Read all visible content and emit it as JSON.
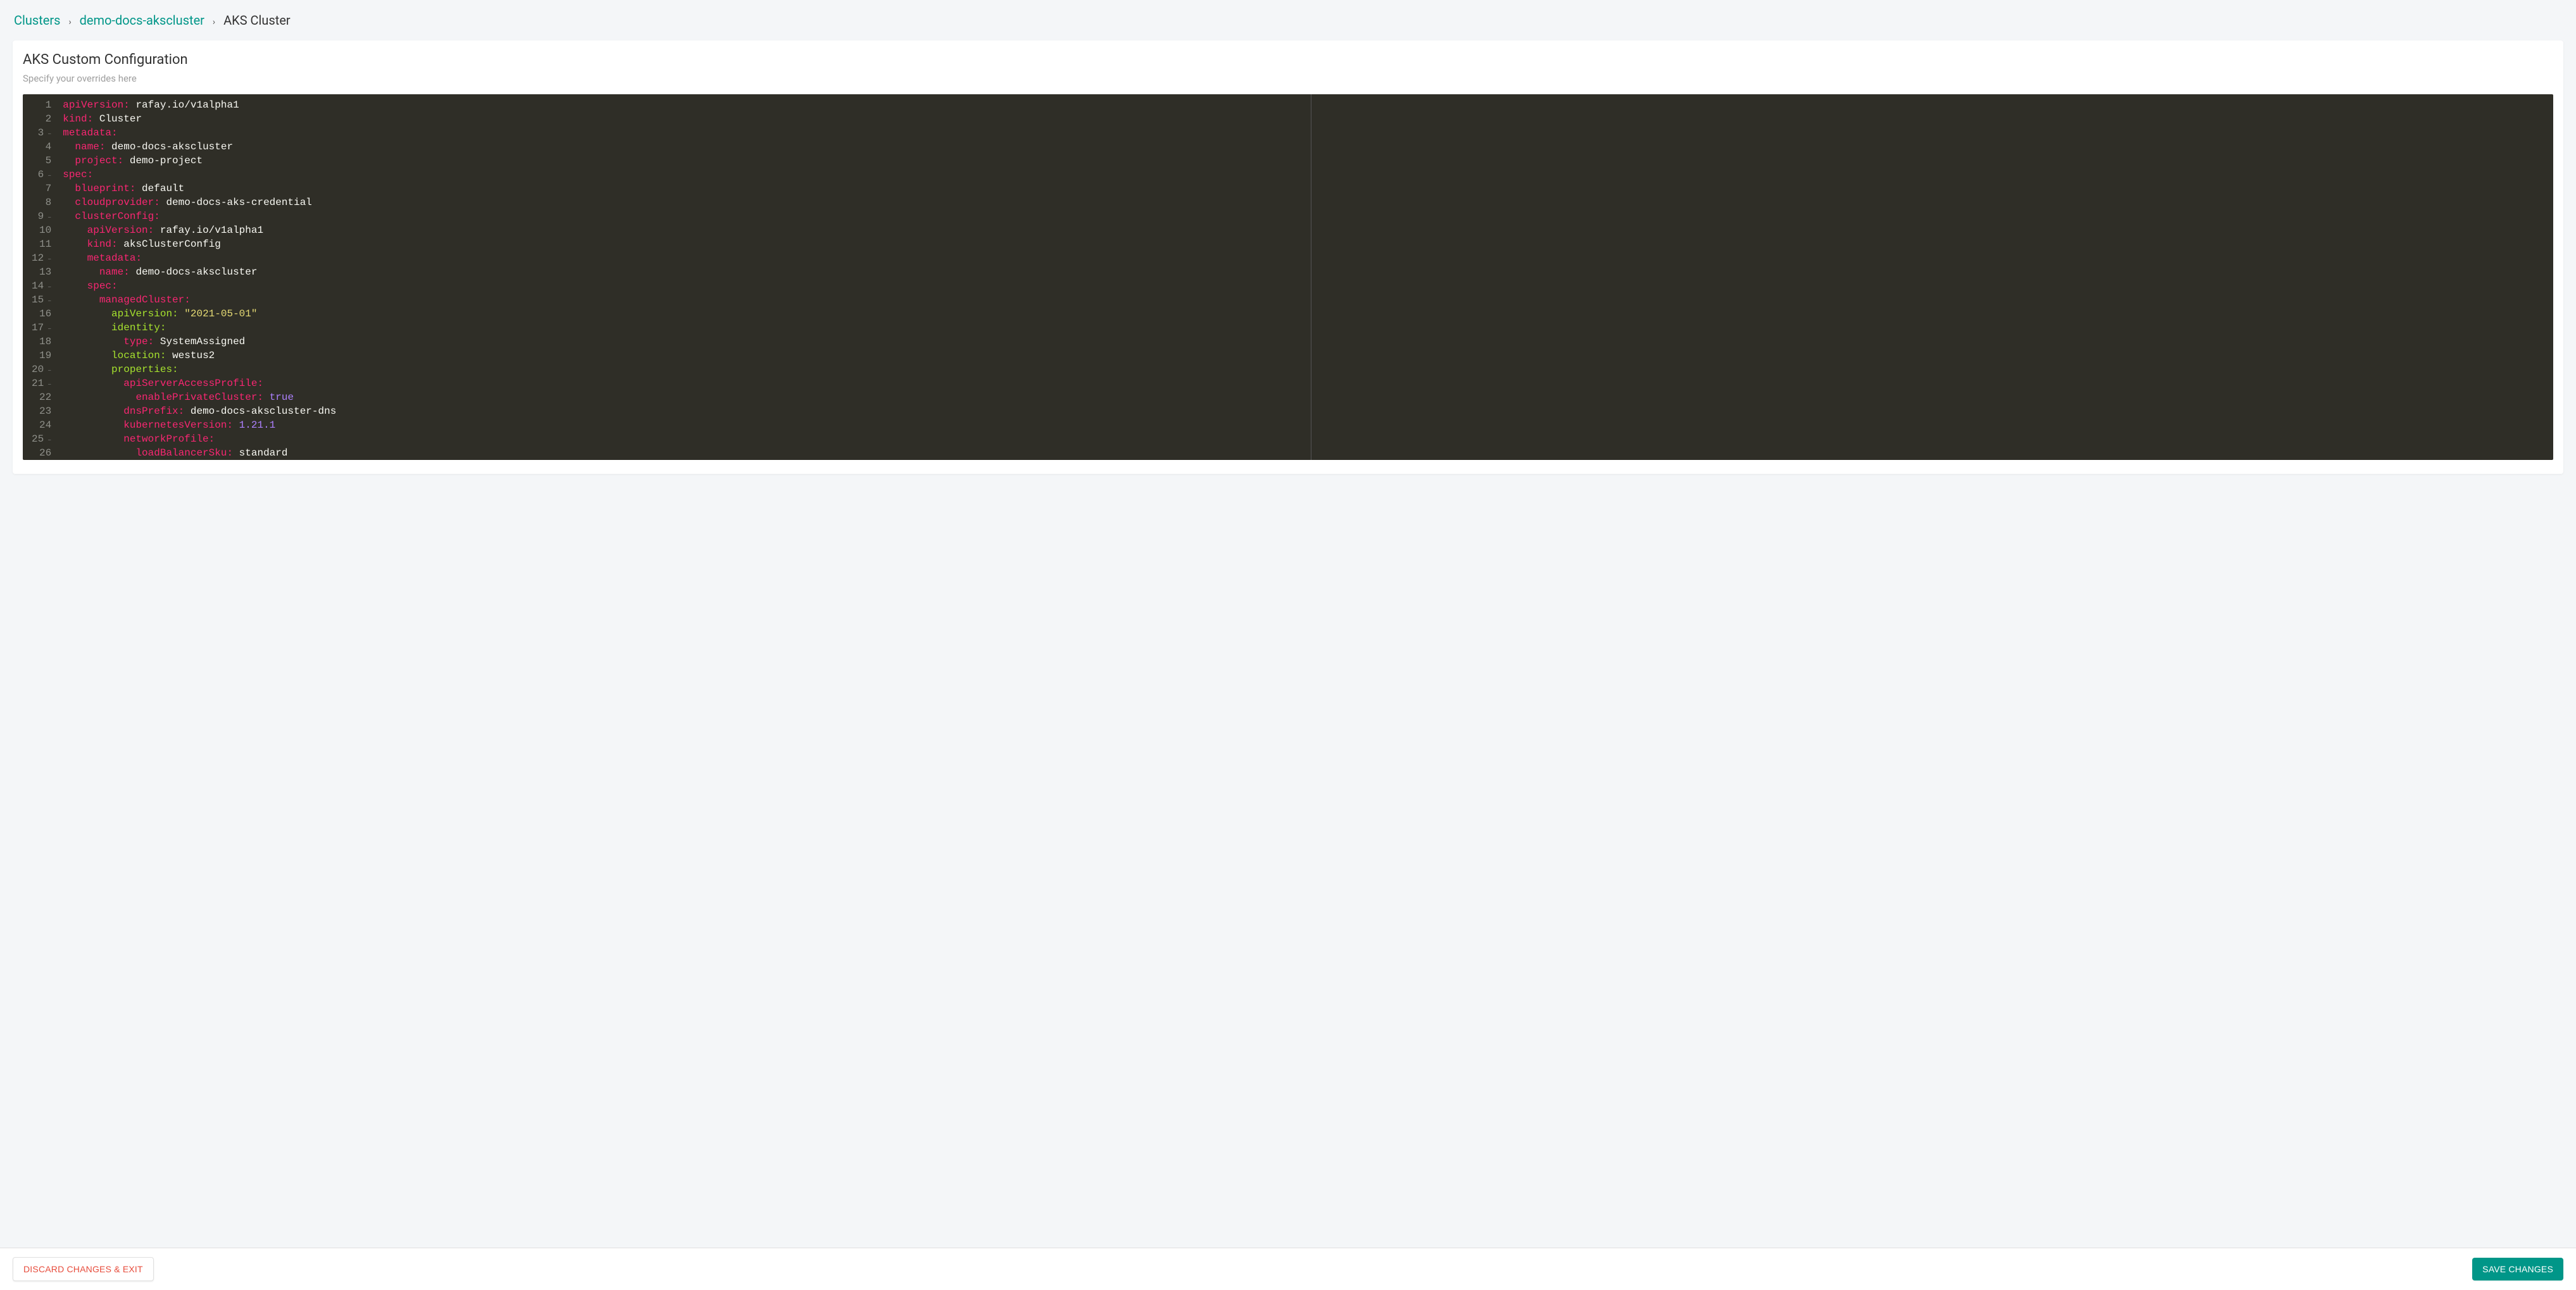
{
  "breadcrumb": {
    "root": "Clusters",
    "mid": "demo-docs-akscluster",
    "leaf": "AKS Cluster",
    "sep": "›"
  },
  "card": {
    "title": "AKS Custom Configuration",
    "sub": "Specify your overrides here"
  },
  "buttons": {
    "discard": "DISCARD CHANGES & EXIT",
    "save": "SAVE CHANGES"
  },
  "editor": {
    "lines": [
      {
        "n": 1,
        "fold": false,
        "tokens": [
          [
            "key",
            "apiVersion:"
          ],
          [
            "sp",
            " "
          ],
          [
            "val",
            "rafay.io/v1alpha1"
          ]
        ]
      },
      {
        "n": 2,
        "fold": false,
        "tokens": [
          [
            "key",
            "kind:"
          ],
          [
            "sp",
            " "
          ],
          [
            "val",
            "Cluster"
          ]
        ]
      },
      {
        "n": 3,
        "fold": true,
        "tokens": [
          [
            "key",
            "metadata:"
          ]
        ]
      },
      {
        "n": 4,
        "fold": false,
        "tokens": [
          [
            "sp",
            "  "
          ],
          [
            "key",
            "name:"
          ],
          [
            "sp",
            " "
          ],
          [
            "val",
            "demo-docs-akscluster"
          ]
        ]
      },
      {
        "n": 5,
        "fold": false,
        "tokens": [
          [
            "sp",
            "  "
          ],
          [
            "key",
            "project:"
          ],
          [
            "sp",
            " "
          ],
          [
            "val",
            "demo-project"
          ]
        ]
      },
      {
        "n": 6,
        "fold": true,
        "tokens": [
          [
            "key",
            "spec:"
          ]
        ]
      },
      {
        "n": 7,
        "fold": false,
        "tokens": [
          [
            "sp",
            "  "
          ],
          [
            "key",
            "blueprint:"
          ],
          [
            "sp",
            " "
          ],
          [
            "val",
            "default"
          ]
        ]
      },
      {
        "n": 8,
        "fold": false,
        "tokens": [
          [
            "sp",
            "  "
          ],
          [
            "key",
            "cloudprovider:"
          ],
          [
            "sp",
            " "
          ],
          [
            "val",
            "demo-docs-aks-credential"
          ]
        ]
      },
      {
        "n": 9,
        "fold": true,
        "tokens": [
          [
            "sp",
            "  "
          ],
          [
            "key",
            "clusterConfig:"
          ]
        ]
      },
      {
        "n": 10,
        "fold": false,
        "tokens": [
          [
            "sp",
            "    "
          ],
          [
            "key",
            "apiVersion:"
          ],
          [
            "sp",
            " "
          ],
          [
            "val",
            "rafay.io/v1alpha1"
          ]
        ]
      },
      {
        "n": 11,
        "fold": false,
        "tokens": [
          [
            "sp",
            "    "
          ],
          [
            "key",
            "kind:"
          ],
          [
            "sp",
            " "
          ],
          [
            "val",
            "aksClusterConfig"
          ]
        ]
      },
      {
        "n": 12,
        "fold": true,
        "tokens": [
          [
            "sp",
            "    "
          ],
          [
            "key",
            "metadata:"
          ]
        ]
      },
      {
        "n": 13,
        "fold": false,
        "tokens": [
          [
            "sp",
            "      "
          ],
          [
            "key",
            "name:"
          ],
          [
            "sp",
            " "
          ],
          [
            "val",
            "demo-docs-akscluster"
          ]
        ]
      },
      {
        "n": 14,
        "fold": true,
        "tokens": [
          [
            "sp",
            "    "
          ],
          [
            "key",
            "spec:"
          ]
        ]
      },
      {
        "n": 15,
        "fold": true,
        "tokens": [
          [
            "sp",
            "      "
          ],
          [
            "key",
            "managedCluster:"
          ]
        ]
      },
      {
        "n": 16,
        "fold": false,
        "tokens": [
          [
            "sp",
            "        "
          ],
          [
            "green",
            "apiVersion:"
          ],
          [
            "sp",
            " "
          ],
          [
            "str",
            "\"2021-05-01\""
          ]
        ]
      },
      {
        "n": 17,
        "fold": true,
        "tokens": [
          [
            "sp",
            "        "
          ],
          [
            "green",
            "identity:"
          ]
        ]
      },
      {
        "n": 18,
        "fold": false,
        "tokens": [
          [
            "sp",
            "          "
          ],
          [
            "key",
            "type:"
          ],
          [
            "sp",
            " "
          ],
          [
            "val",
            "SystemAssigned"
          ]
        ]
      },
      {
        "n": 19,
        "fold": false,
        "tokens": [
          [
            "sp",
            "        "
          ],
          [
            "green",
            "location:"
          ],
          [
            "sp",
            " "
          ],
          [
            "val",
            "westus2"
          ]
        ]
      },
      {
        "n": 20,
        "fold": true,
        "tokens": [
          [
            "sp",
            "        "
          ],
          [
            "green",
            "properties:"
          ]
        ]
      },
      {
        "n": 21,
        "fold": true,
        "tokens": [
          [
            "sp",
            "          "
          ],
          [
            "key",
            "apiServerAccessProfile:"
          ]
        ]
      },
      {
        "n": 22,
        "fold": false,
        "tokens": [
          [
            "sp",
            "            "
          ],
          [
            "key",
            "enablePrivateCluster:"
          ],
          [
            "sp",
            " "
          ],
          [
            "bool",
            "true"
          ]
        ]
      },
      {
        "n": 23,
        "fold": false,
        "tokens": [
          [
            "sp",
            "          "
          ],
          [
            "key",
            "dnsPrefix:"
          ],
          [
            "sp",
            " "
          ],
          [
            "val",
            "demo-docs-akscluster-dns"
          ]
        ]
      },
      {
        "n": 24,
        "fold": false,
        "tokens": [
          [
            "sp",
            "          "
          ],
          [
            "key",
            "kubernetesVersion:"
          ],
          [
            "sp",
            " "
          ],
          [
            "bool",
            "1.21.1"
          ]
        ]
      },
      {
        "n": 25,
        "fold": true,
        "tokens": [
          [
            "sp",
            "          "
          ],
          [
            "key",
            "networkProfile:"
          ]
        ]
      },
      {
        "n": 26,
        "fold": false,
        "tokens": [
          [
            "sp",
            "            "
          ],
          [
            "key",
            "loadBalancerSku:"
          ],
          [
            "sp",
            " "
          ],
          [
            "val",
            "standard"
          ]
        ]
      }
    ]
  }
}
